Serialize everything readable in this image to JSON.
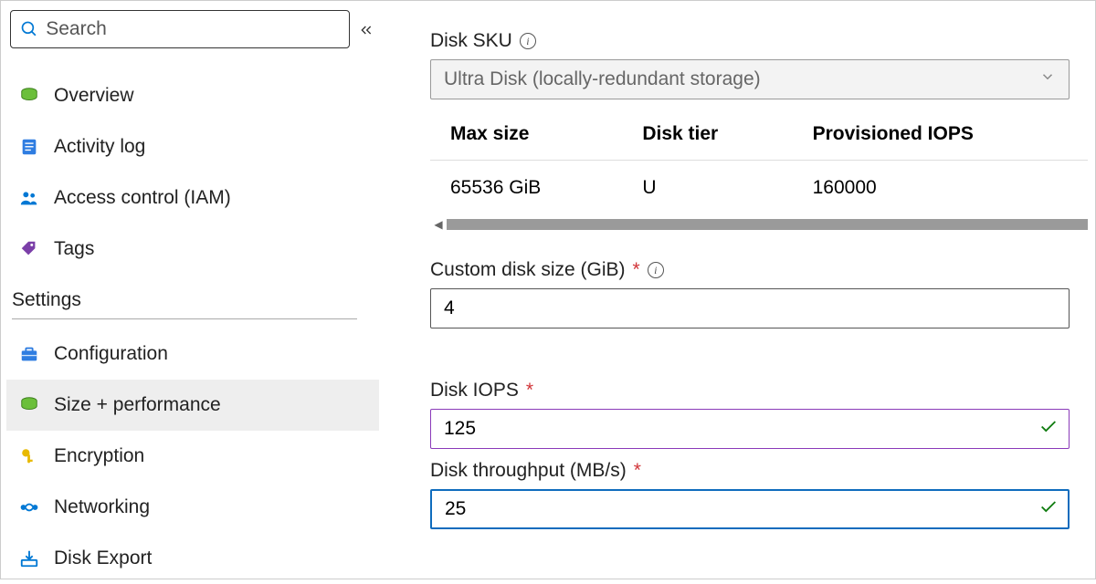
{
  "search": {
    "placeholder": "Search"
  },
  "nav": {
    "overview": "Overview",
    "activity_log": "Activity log",
    "access_control": "Access control (IAM)",
    "tags": "Tags"
  },
  "settings_header": "Settings",
  "settings": {
    "configuration": "Configuration",
    "size_perf": "Size + performance",
    "encryption": "Encryption",
    "networking": "Networking",
    "disk_export": "Disk Export"
  },
  "main": {
    "disk_sku_label": "Disk SKU",
    "disk_sku_value": "Ultra Disk (locally-redundant storage)",
    "table": {
      "headers": {
        "max_size": "Max size",
        "disk_tier": "Disk tier",
        "prov_iops": "Provisioned IOPS"
      },
      "row": {
        "max_size": "65536 GiB",
        "disk_tier": "U",
        "prov_iops": "160000"
      }
    },
    "custom_size_label": "Custom disk size (GiB)",
    "custom_size_value": "4",
    "disk_iops_label": "Disk IOPS",
    "disk_iops_value": "125",
    "disk_throughput_label": "Disk throughput (MB/s)",
    "disk_throughput_value": "25"
  }
}
